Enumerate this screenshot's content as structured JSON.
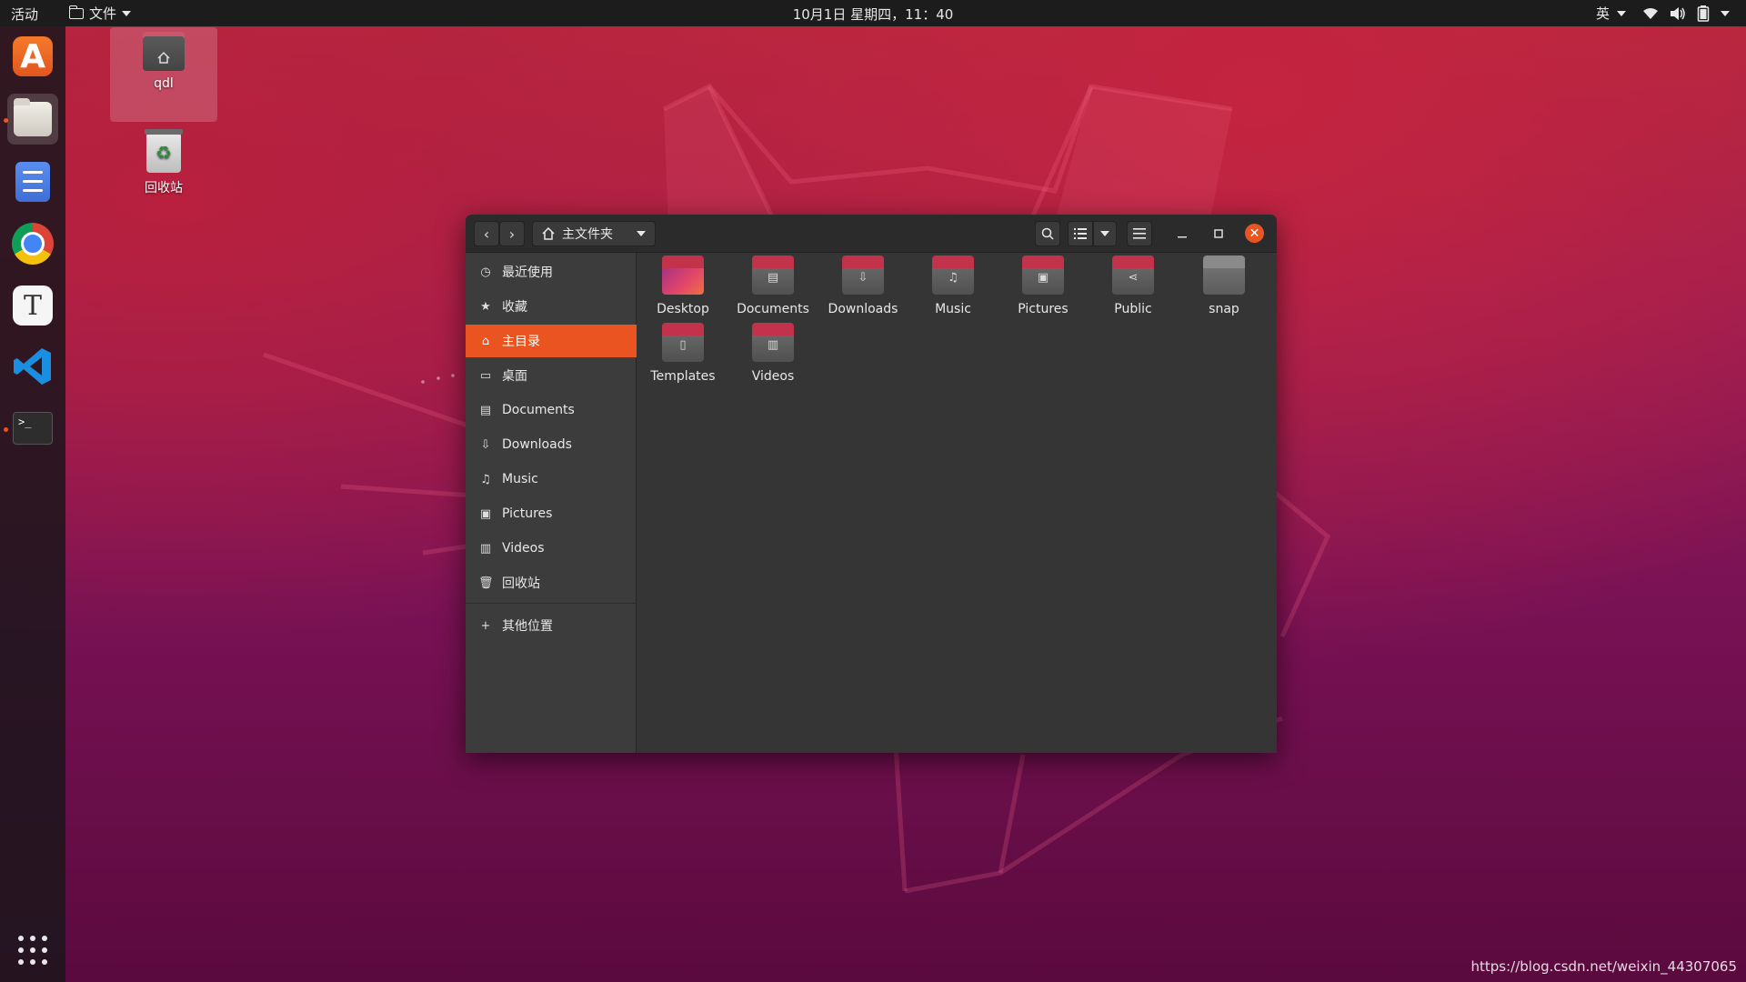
{
  "topbar": {
    "activities": "活动",
    "app_menu": "文件",
    "clock": "10月1日 星期四，11：40",
    "input_method": "英"
  },
  "dock": {
    "apps": [
      "ubuntu-software",
      "files",
      "todo",
      "chrome",
      "text-editor",
      "vscode",
      "terminal"
    ],
    "terminal_prompt": ">_"
  },
  "desktop": {
    "icons": [
      {
        "label": "qdl",
        "icon": "home-folder-icon"
      },
      {
        "label": "回收站",
        "icon": "trash-icon"
      }
    ]
  },
  "window": {
    "path_label": "主文件夹",
    "sidebar": {
      "items": [
        {
          "label": "最近使用",
          "icon": "clock-icon"
        },
        {
          "label": "收藏",
          "icon": "star-icon"
        },
        {
          "label": "主目录",
          "icon": "home-icon",
          "active": true
        },
        {
          "label": "桌面",
          "icon": "desktop-icon"
        },
        {
          "label": "Documents",
          "icon": "document-icon"
        },
        {
          "label": "Downloads",
          "icon": "download-icon"
        },
        {
          "label": "Music",
          "icon": "music-icon"
        },
        {
          "label": "Pictures",
          "icon": "image-icon"
        },
        {
          "label": "Videos",
          "icon": "film-icon"
        },
        {
          "label": "回收站",
          "icon": "trash-icon"
        }
      ],
      "other_locations": "其他位置"
    },
    "files": [
      {
        "label": "Desktop"
      },
      {
        "label": "Documents"
      },
      {
        "label": "Downloads"
      },
      {
        "label": "Music"
      },
      {
        "label": "Pictures"
      },
      {
        "label": "Public"
      },
      {
        "label": "snap"
      },
      {
        "label": "Templates"
      },
      {
        "label": "Videos"
      }
    ]
  },
  "colors": {
    "accent": "#e95420",
    "topbar": "#1c1c1c",
    "window_bg": "#353535",
    "sidebar_bg": "#3c3c3c"
  },
  "watermark": "https://blog.csdn.net/weixin_44307065"
}
